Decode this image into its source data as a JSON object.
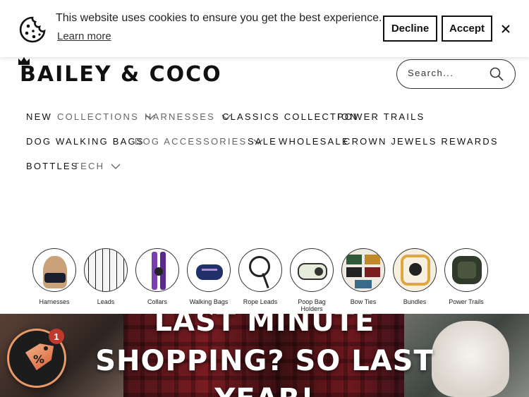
{
  "cookie_banner": {
    "message": "This website uses cookies to ensure you get the best experience.",
    "learn_more": "Learn more",
    "decline_label": "Decline",
    "accept_label": "Accept"
  },
  "header": {
    "logo_text": "BAILEY & COCO",
    "search_placeholder": "Search..."
  },
  "nav": {
    "row1": [
      {
        "label": "NEW",
        "dropdown": false
      },
      {
        "label": "COLLECTIONS",
        "dropdown": true
      },
      {
        "label": "HARNESSES",
        "dropdown": true
      },
      {
        "label": "CLASSICS COLLECTION",
        "dropdown": false
      },
      {
        "label": "POWER TRAILS",
        "dropdown": false
      }
    ],
    "row2": [
      {
        "label": "DOG WALKING BAGS",
        "dropdown": false
      },
      {
        "label": "DOG ACCESSORIES",
        "dropdown": true
      },
      {
        "label": "SALE",
        "dropdown": false
      },
      {
        "label": "WHOLESALE",
        "dropdown": false
      },
      {
        "label": "CROWN JEWELS REWARDS",
        "dropdown": false
      }
    ],
    "row3": [
      {
        "label": "BOTTLES",
        "dropdown": false
      },
      {
        "label": "TECH",
        "dropdown": true
      }
    ]
  },
  "categories": [
    {
      "label": "Harnesses"
    },
    {
      "label": "Leads"
    },
    {
      "label": "Collars"
    },
    {
      "label": "Walking Bags"
    },
    {
      "label": "Rope Leads"
    },
    {
      "label": "Poop Bag Holders"
    },
    {
      "label": "Bow Ties"
    },
    {
      "label": "Bundles"
    },
    {
      "label": "Power Trails"
    }
  ],
  "hero": {
    "line1": "LAST MINUTE",
    "line2": "SHOPPING? SO LAST",
    "line3": "YEAR!"
  },
  "promo": {
    "count": "1"
  }
}
